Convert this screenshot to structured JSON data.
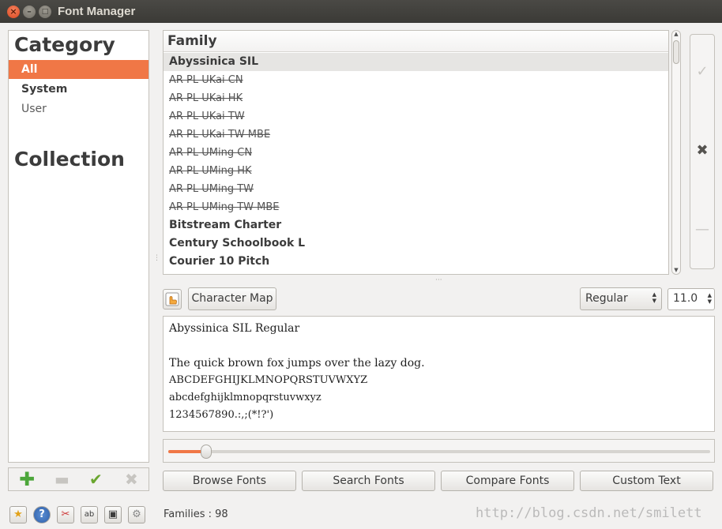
{
  "window": {
    "title": "Font Manager",
    "controls": {
      "close": "×",
      "minimize": "–",
      "maximize": "□"
    }
  },
  "sidebar": {
    "category_heading": "Category",
    "categories": [
      {
        "label": "All",
        "selected": true
      },
      {
        "label": "System"
      },
      {
        "label": "User"
      }
    ],
    "collection_heading": "Collection",
    "tools": {
      "add_icon": "plus-icon",
      "remove_icon": "minus-icon",
      "enable_icon": "check-icon",
      "disable_icon": "x-icon"
    }
  },
  "families": {
    "header": "Family",
    "items": [
      {
        "label": "Abyssinica SIL",
        "selected": true
      },
      {
        "label": "AR PL UKai CN",
        "disabled": true
      },
      {
        "label": "AR PL UKai HK",
        "disabled": true
      },
      {
        "label": "AR PL UKai TW",
        "disabled": true
      },
      {
        "label": "AR PL UKai TW MBE",
        "disabled": true
      },
      {
        "label": "AR PL UMing CN",
        "disabled": true
      },
      {
        "label": "AR PL UMing HK",
        "disabled": true
      },
      {
        "label": "AR PL UMing TW",
        "disabled": true
      },
      {
        "label": "AR PL UMing TW MBE",
        "disabled": true
      },
      {
        "label": "Bitstream Charter"
      },
      {
        "label": "Century Schoolbook L"
      },
      {
        "label": "Courier 10 Pitch"
      }
    ]
  },
  "actions": {
    "enable": "✓",
    "disable": "✖",
    "remove": "—"
  },
  "controls": {
    "character_map_label": "Character Map",
    "style_value": "Regular",
    "size_value": "11.0",
    "size_slider_fraction": 0.07
  },
  "preview": {
    "heading": "Abyssinica SIL Regular",
    "sentence": "The quick brown fox jumps over the lazy dog.",
    "uppercase": "ABCDEFGHIJKLMNOPQRSTUVWXYZ",
    "lowercase": "abcdefghijklmnopqrstuvwxyz",
    "numerals": "1234567890.:,;(*!?')"
  },
  "nav_buttons": {
    "browse": "Browse Fonts",
    "search": "Search Fonts",
    "compare": "Compare Fonts",
    "custom": "Custom Text"
  },
  "status": {
    "families_count": "Families : 98",
    "icons": [
      "star-icon",
      "help-icon",
      "settings-icon",
      "font-info-icon",
      "save-icon",
      "export-icon"
    ]
  },
  "watermark": "http://blog.csdn.net/smilett"
}
